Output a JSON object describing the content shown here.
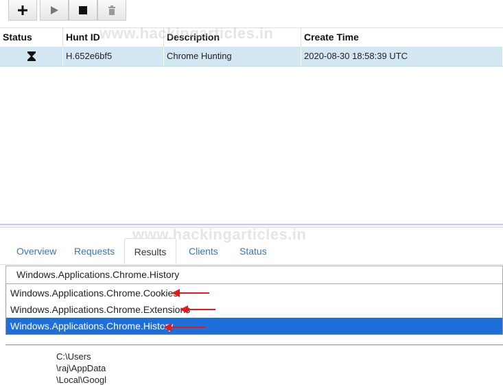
{
  "toolbar": {
    "buttons": [
      {
        "name": "add",
        "icon": "plus-icon"
      },
      {
        "name": "run",
        "icon": "play-icon"
      },
      {
        "name": "stop",
        "icon": "stop-icon"
      },
      {
        "name": "delete",
        "icon": "trash-icon"
      }
    ]
  },
  "hunts": {
    "columns": [
      "Status",
      "Hunt ID",
      "Description",
      "Create Time"
    ],
    "rows": [
      {
        "status_icon": "hourglass-icon",
        "hunt_id": "H.652e6bf5",
        "description": "Chrome Hunting",
        "create_time": "2020-08-30 18:58:39 UTC"
      }
    ]
  },
  "watermark": "www.hackingarticles.in",
  "tabs": [
    "Overview",
    "Requests",
    "Results",
    "Clients",
    "Status"
  ],
  "active_tab": "Results",
  "artifact_select": {
    "value": "Windows.Applications.Chrome.History",
    "options": [
      "Windows.Applications.Chrome.Cookies",
      "Windows.Applications.Chrome.Extensions",
      "Windows.Applications.Chrome.History"
    ],
    "selected_index": 2
  },
  "results_preview": {
    "lines": [
      "C:\\Users",
      "\\raj\\AppData",
      "\\Local\\Googl"
    ]
  },
  "colors": {
    "row_selected": "#d3e7f2",
    "option_selected": "#1e6fd9",
    "tab_link": "#3a76b4",
    "annotation_arrow": "#e31b1b"
  }
}
